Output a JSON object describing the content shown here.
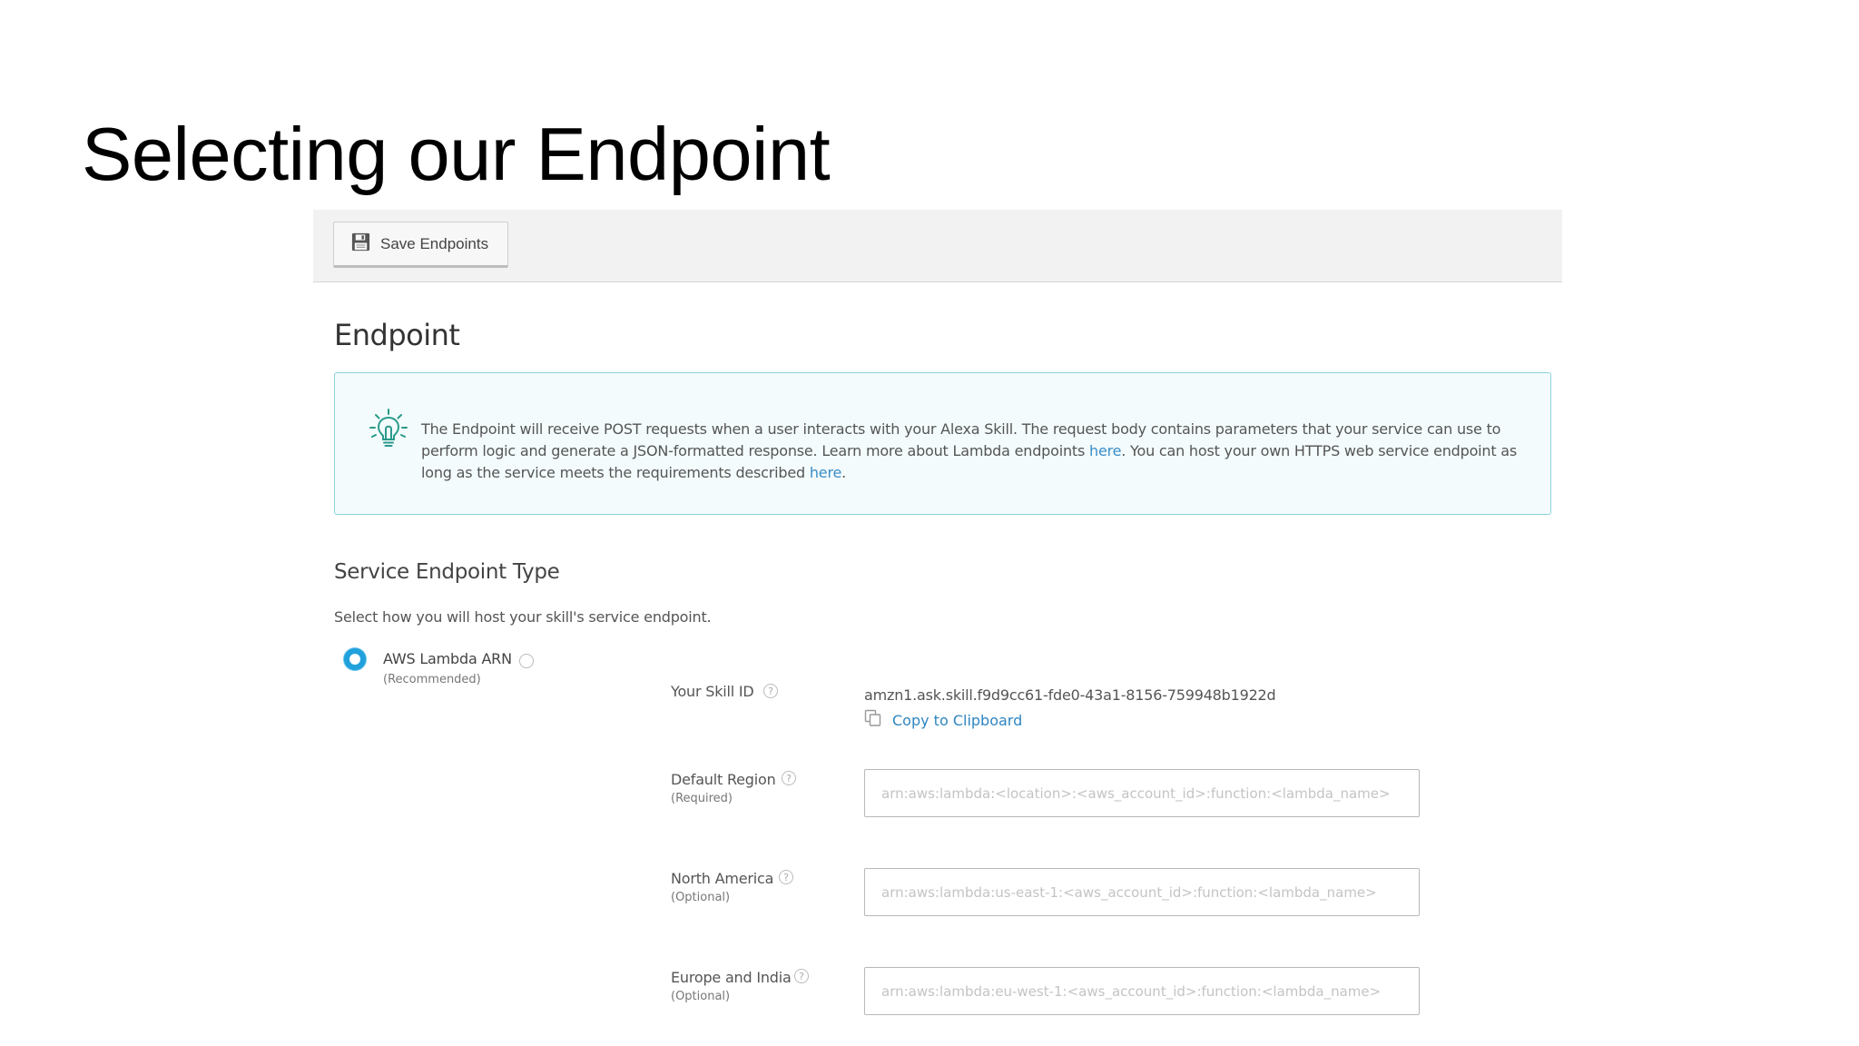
{
  "slide": {
    "title": "Selecting our Endpoint"
  },
  "toolbar": {
    "save_label": "Save Endpoints"
  },
  "section": {
    "title": "Endpoint"
  },
  "info": {
    "text_1": "The Endpoint will receive POST requests when a user interacts with your Alexa Skill. The request body contains parameters that your service can use to perform logic and generate a JSON-formatted response. Learn more about Lambda endpoints ",
    "link_1": "here",
    "text_2": ". You can host your own HTTPS web service endpoint as long as the service meets the requirements described ",
    "link_2": "here",
    "text_3": "."
  },
  "endpoint_type": {
    "title": "Service Endpoint Type",
    "description": "Select how you will host your skill's service endpoint.",
    "option": {
      "label": "AWS Lambda ARN",
      "sub": "(Recommended)",
      "selected": true
    }
  },
  "skill": {
    "label": "Your Skill ID",
    "id": "amzn1.ask.skill.f9d9cc61-fde0-43a1-8156-759948b1922d",
    "copy_label": "Copy to Clipboard"
  },
  "regions": [
    {
      "label": "Default Region",
      "sub": "(Required)",
      "value": "",
      "placeholder": "arn:aws:lambda:<location>:<aws_account_id>:function:<lambda_name>"
    },
    {
      "label": "North America",
      "sub": "(Optional)",
      "value": "",
      "placeholder": "arn:aws:lambda:us-east-1:<aws_account_id>:function:<lambda_name>"
    },
    {
      "label": "Europe and India",
      "sub": "(Optional)",
      "value": "",
      "placeholder": "arn:aws:lambda:eu-west-1:<aws_account_id>:function:<lambda_name>"
    }
  ],
  "colors": {
    "accent": "#21a1dc",
    "link": "#2e86c1",
    "info_border": "#8fd3dc",
    "info_bg": "#f3fbfc"
  },
  "icons": {
    "save": "floppy-disk-icon",
    "info": "lightbulb-icon",
    "help": "question-circle-icon",
    "copy": "copy-icon"
  }
}
